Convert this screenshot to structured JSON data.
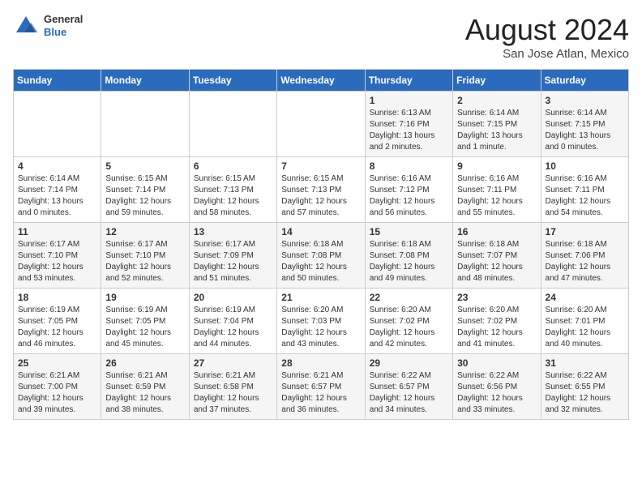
{
  "logo": {
    "general": "General",
    "blue": "Blue"
  },
  "header": {
    "month_year": "August 2024",
    "location": "San Jose Atlan, Mexico"
  },
  "days_of_week": [
    "Sunday",
    "Monday",
    "Tuesday",
    "Wednesday",
    "Thursday",
    "Friday",
    "Saturday"
  ],
  "weeks": [
    [
      {
        "day": "",
        "info": ""
      },
      {
        "day": "",
        "info": ""
      },
      {
        "day": "",
        "info": ""
      },
      {
        "day": "",
        "info": ""
      },
      {
        "day": "1",
        "info": "Sunrise: 6:13 AM\nSunset: 7:16 PM\nDaylight: 13 hours\nand 2 minutes."
      },
      {
        "day": "2",
        "info": "Sunrise: 6:14 AM\nSunset: 7:15 PM\nDaylight: 13 hours\nand 1 minute."
      },
      {
        "day": "3",
        "info": "Sunrise: 6:14 AM\nSunset: 7:15 PM\nDaylight: 13 hours\nand 0 minutes."
      }
    ],
    [
      {
        "day": "4",
        "info": "Sunrise: 6:14 AM\nSunset: 7:14 PM\nDaylight: 13 hours\nand 0 minutes."
      },
      {
        "day": "5",
        "info": "Sunrise: 6:15 AM\nSunset: 7:14 PM\nDaylight: 12 hours\nand 59 minutes."
      },
      {
        "day": "6",
        "info": "Sunrise: 6:15 AM\nSunset: 7:13 PM\nDaylight: 12 hours\nand 58 minutes."
      },
      {
        "day": "7",
        "info": "Sunrise: 6:15 AM\nSunset: 7:13 PM\nDaylight: 12 hours\nand 57 minutes."
      },
      {
        "day": "8",
        "info": "Sunrise: 6:16 AM\nSunset: 7:12 PM\nDaylight: 12 hours\nand 56 minutes."
      },
      {
        "day": "9",
        "info": "Sunrise: 6:16 AM\nSunset: 7:11 PM\nDaylight: 12 hours\nand 55 minutes."
      },
      {
        "day": "10",
        "info": "Sunrise: 6:16 AM\nSunset: 7:11 PM\nDaylight: 12 hours\nand 54 minutes."
      }
    ],
    [
      {
        "day": "11",
        "info": "Sunrise: 6:17 AM\nSunset: 7:10 PM\nDaylight: 12 hours\nand 53 minutes."
      },
      {
        "day": "12",
        "info": "Sunrise: 6:17 AM\nSunset: 7:10 PM\nDaylight: 12 hours\nand 52 minutes."
      },
      {
        "day": "13",
        "info": "Sunrise: 6:17 AM\nSunset: 7:09 PM\nDaylight: 12 hours\nand 51 minutes."
      },
      {
        "day": "14",
        "info": "Sunrise: 6:18 AM\nSunset: 7:08 PM\nDaylight: 12 hours\nand 50 minutes."
      },
      {
        "day": "15",
        "info": "Sunrise: 6:18 AM\nSunset: 7:08 PM\nDaylight: 12 hours\nand 49 minutes."
      },
      {
        "day": "16",
        "info": "Sunrise: 6:18 AM\nSunset: 7:07 PM\nDaylight: 12 hours\nand 48 minutes."
      },
      {
        "day": "17",
        "info": "Sunrise: 6:18 AM\nSunset: 7:06 PM\nDaylight: 12 hours\nand 47 minutes."
      }
    ],
    [
      {
        "day": "18",
        "info": "Sunrise: 6:19 AM\nSunset: 7:05 PM\nDaylight: 12 hours\nand 46 minutes."
      },
      {
        "day": "19",
        "info": "Sunrise: 6:19 AM\nSunset: 7:05 PM\nDaylight: 12 hours\nand 45 minutes."
      },
      {
        "day": "20",
        "info": "Sunrise: 6:19 AM\nSunset: 7:04 PM\nDaylight: 12 hours\nand 44 minutes."
      },
      {
        "day": "21",
        "info": "Sunrise: 6:20 AM\nSunset: 7:03 PM\nDaylight: 12 hours\nand 43 minutes."
      },
      {
        "day": "22",
        "info": "Sunrise: 6:20 AM\nSunset: 7:02 PM\nDaylight: 12 hours\nand 42 minutes."
      },
      {
        "day": "23",
        "info": "Sunrise: 6:20 AM\nSunset: 7:02 PM\nDaylight: 12 hours\nand 41 minutes."
      },
      {
        "day": "24",
        "info": "Sunrise: 6:20 AM\nSunset: 7:01 PM\nDaylight: 12 hours\nand 40 minutes."
      }
    ],
    [
      {
        "day": "25",
        "info": "Sunrise: 6:21 AM\nSunset: 7:00 PM\nDaylight: 12 hours\nand 39 minutes."
      },
      {
        "day": "26",
        "info": "Sunrise: 6:21 AM\nSunset: 6:59 PM\nDaylight: 12 hours\nand 38 minutes."
      },
      {
        "day": "27",
        "info": "Sunrise: 6:21 AM\nSunset: 6:58 PM\nDaylight: 12 hours\nand 37 minutes."
      },
      {
        "day": "28",
        "info": "Sunrise: 6:21 AM\nSunset: 6:57 PM\nDaylight: 12 hours\nand 36 minutes."
      },
      {
        "day": "29",
        "info": "Sunrise: 6:22 AM\nSunset: 6:57 PM\nDaylight: 12 hours\nand 34 minutes."
      },
      {
        "day": "30",
        "info": "Sunrise: 6:22 AM\nSunset: 6:56 PM\nDaylight: 12 hours\nand 33 minutes."
      },
      {
        "day": "31",
        "info": "Sunrise: 6:22 AM\nSunset: 6:55 PM\nDaylight: 12 hours\nand 32 minutes."
      }
    ]
  ]
}
